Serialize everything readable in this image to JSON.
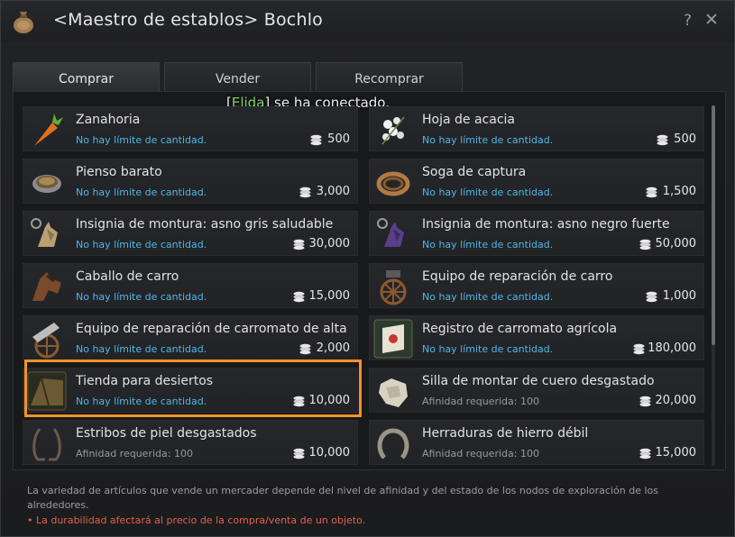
{
  "window": {
    "title": "<Maestro de establos> Bochlo",
    "help": "?",
    "close": "✕"
  },
  "tabs": [
    {
      "label": "Comprar",
      "active": true
    },
    {
      "label": "Vender",
      "active": false
    },
    {
      "label": "Recomprar",
      "active": false
    }
  ],
  "notice": {
    "open": "[",
    "name": "Elida",
    "close": "]",
    "text": " se ha conectado."
  },
  "items": [
    {
      "name": "Zanahoria",
      "sub": "No hay límite de cantidad.",
      "price": "500",
      "icon": "carrot-icon"
    },
    {
      "name": "Hoja de acacia",
      "sub": "No hay límite de cantidad.",
      "price": "500",
      "icon": "acacia-leaf-icon"
    },
    {
      "name": "Pienso barato",
      "sub": "No hay límite de cantidad.",
      "price": "3,000",
      "icon": "feed-bowl-icon"
    },
    {
      "name": "Soga de captura",
      "sub": "No hay límite de cantidad.",
      "price": "1,500",
      "icon": "rope-icon"
    },
    {
      "name": "Insignia de montura: asno gris saludable",
      "sub": "No hay límite de cantidad.",
      "price": "30,000",
      "icon": "donkey-gray-badge-icon"
    },
    {
      "name": "Insignia de montura: asno negro fuerte",
      "sub": "No hay límite de cantidad.",
      "price": "50,000",
      "icon": "donkey-black-badge-icon"
    },
    {
      "name": "Caballo de carro",
      "sub": "No hay límite de cantidad.",
      "price": "15,000",
      "icon": "cart-horse-icon"
    },
    {
      "name": "Equipo de reparación de carro",
      "sub": "No hay límite de cantidad.",
      "price": "1,000",
      "icon": "cart-repair-kit-icon"
    },
    {
      "name": "Equipo de reparación de carromato de alta ...",
      "sub": "No hay límite de cantidad.",
      "price": "2,000",
      "icon": "wagon-repair-kit-icon"
    },
    {
      "name": "Registro de carromato agrícola",
      "sub": "No hay límite de cantidad.",
      "price": "180,000",
      "icon": "wagon-registration-icon"
    },
    {
      "name": "Tienda para desiertos",
      "sub": "No hay límite de cantidad.",
      "price": "10,000",
      "icon": "desert-tent-icon"
    },
    {
      "name": "Silla de montar de cuero desgastado",
      "sub": "Afinidad requerida: 100",
      "price": "20,000",
      "icon": "saddle-icon"
    },
    {
      "name": "Estribos de piel desgastados",
      "sub": "Afinidad requerida: 100",
      "price": "10,000",
      "icon": "stirrups-icon"
    },
    {
      "name": "Herraduras de hierro débil",
      "sub": "Afinidad requerida: 100",
      "price": "15,000",
      "icon": "horseshoe-icon"
    }
  ],
  "footer": {
    "info": "La variedad de artículos que vende un mercader depende del nivel de afinidad y del estado de los nodos de exploración de los alrededores.",
    "warning": "• La durabilidad afectará al precio de la compra/venta de un objeto."
  },
  "colors": {
    "highlight": "#f39229",
    "quantity_text": "#4fb6e6",
    "notice_name": "#7fd36c",
    "warning": "#e2604c"
  }
}
